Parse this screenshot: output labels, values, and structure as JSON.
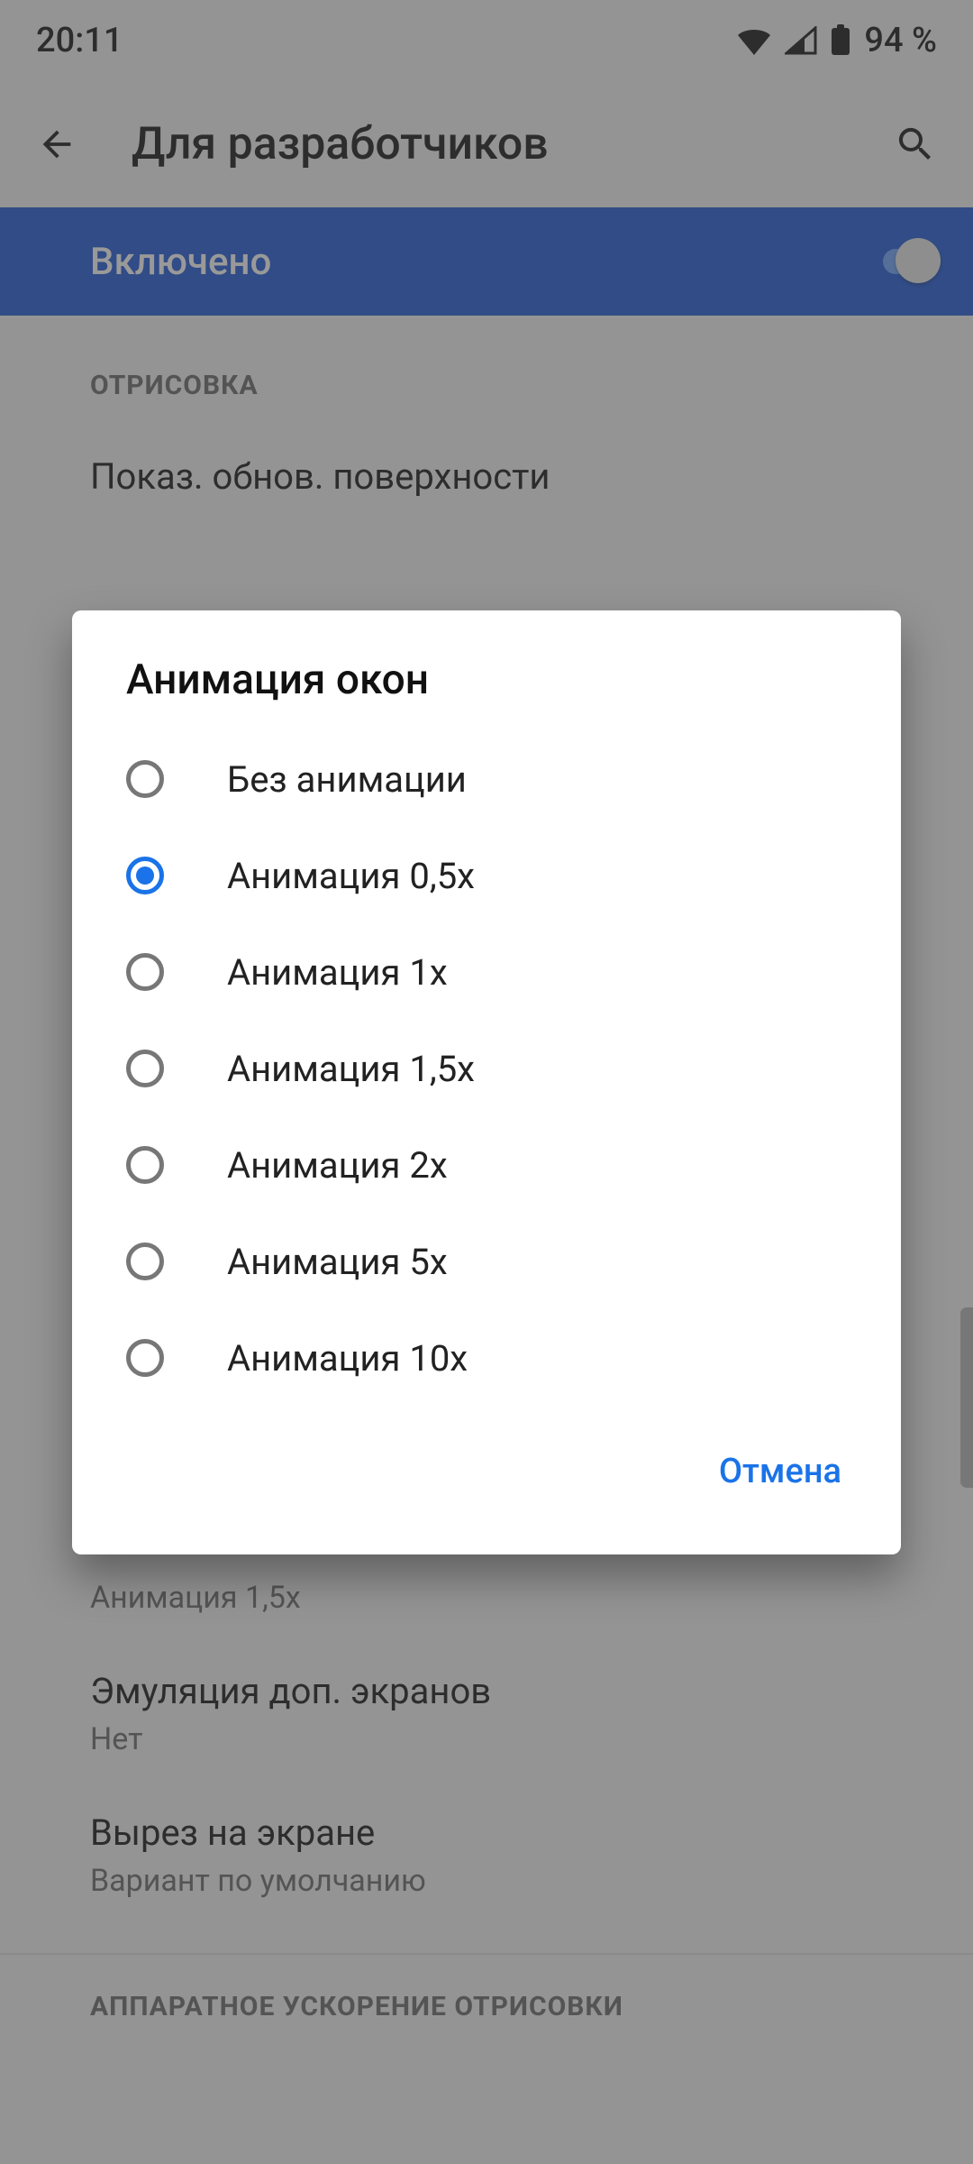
{
  "status_bar": {
    "time": "20:11",
    "battery": "94 %"
  },
  "app_bar": {
    "title": "Для разработчиков"
  },
  "master_switch": {
    "label": "Включено",
    "on": true
  },
  "sections": {
    "drawing_header": "ОТРИСОВКА",
    "hw_accel_header": "АППАРАТНОЕ УСКОРЕНИЕ ОТРИСОВКИ"
  },
  "prefs": {
    "surface_updates_title": "Показ. обнов. поверхности",
    "anim_cutoff_title": "Анимация 1,5x",
    "secondary_display": {
      "title": "Эмуляция доп. экранов",
      "subtitle": "Нет"
    },
    "display_cutout": {
      "title": "Вырез на экране",
      "subtitle": "Вариант по умолчанию"
    }
  },
  "dialog": {
    "title": "Анимация окон",
    "options": [
      "Без анимации",
      "Анимация 0,5x",
      "Анимация 1x",
      "Анимация 1,5x",
      "Анимация 2x",
      "Анимация 5x",
      "Анимация 10x"
    ],
    "selected_index": 1,
    "cancel": "Отмена"
  }
}
